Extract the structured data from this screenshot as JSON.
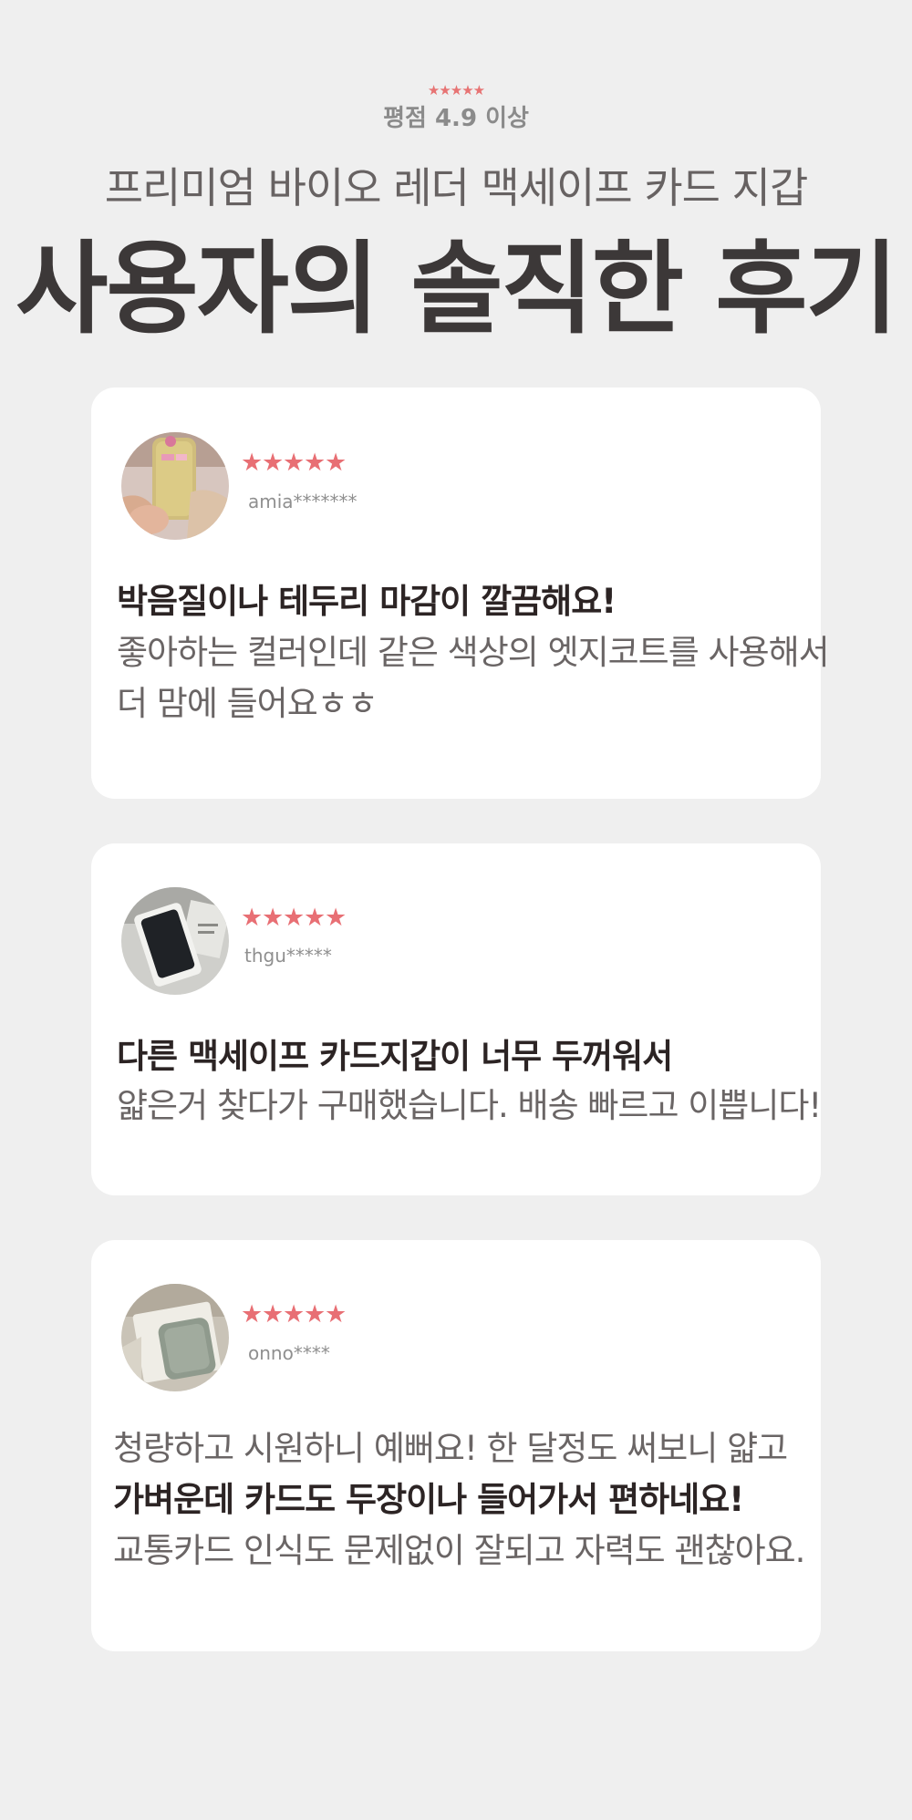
{
  "header": {
    "stars": "★★★★★",
    "rating": "평점 4.9 이상",
    "product_name": "프리미엄 바이오 레더 맥세이프 카드 지갑",
    "title": "사용자의 솔직한 후기"
  },
  "reviews": [
    {
      "stars": [
        "★",
        "★",
        "★",
        "★",
        "★"
      ],
      "username": "amia*******",
      "title": "박음질이나 테두리 마감이 깔끔해요!",
      "body": [
        "좋아하는 컬러인데 같은 색상의 엣지코트를 사용해서",
        "더 맘에 들어요ㅎㅎ"
      ]
    },
    {
      "stars": [
        "★",
        "★",
        "★",
        "★",
        "★"
      ],
      "username": "thgu*****",
      "title": "다른 맥세이프 카드지갑이 너무 두꺼워서",
      "body": [
        "얇은거 찾다가 구매했습니다. 배송 빠르고 이쁩니다!"
      ]
    },
    {
      "stars": [
        "★",
        "★",
        "★",
        "★",
        "★"
      ],
      "username": "onno****",
      "lines": [
        "청량하고 시원하니 예뻐요! 한 달정도 써보니 얇고",
        "가벼운데 카드도 두장이나 들어가서 편하네요!",
        "교통카드 인식도 문제없이 잘되고 자력도 괜찮아요."
      ]
    }
  ],
  "colors": {
    "star": "#e86f74",
    "background": "#efefef",
    "card": "#ffffff",
    "title_text": "#3c3838",
    "body_text": "#6a6565"
  },
  "icons": {
    "rating": "star-icon"
  }
}
